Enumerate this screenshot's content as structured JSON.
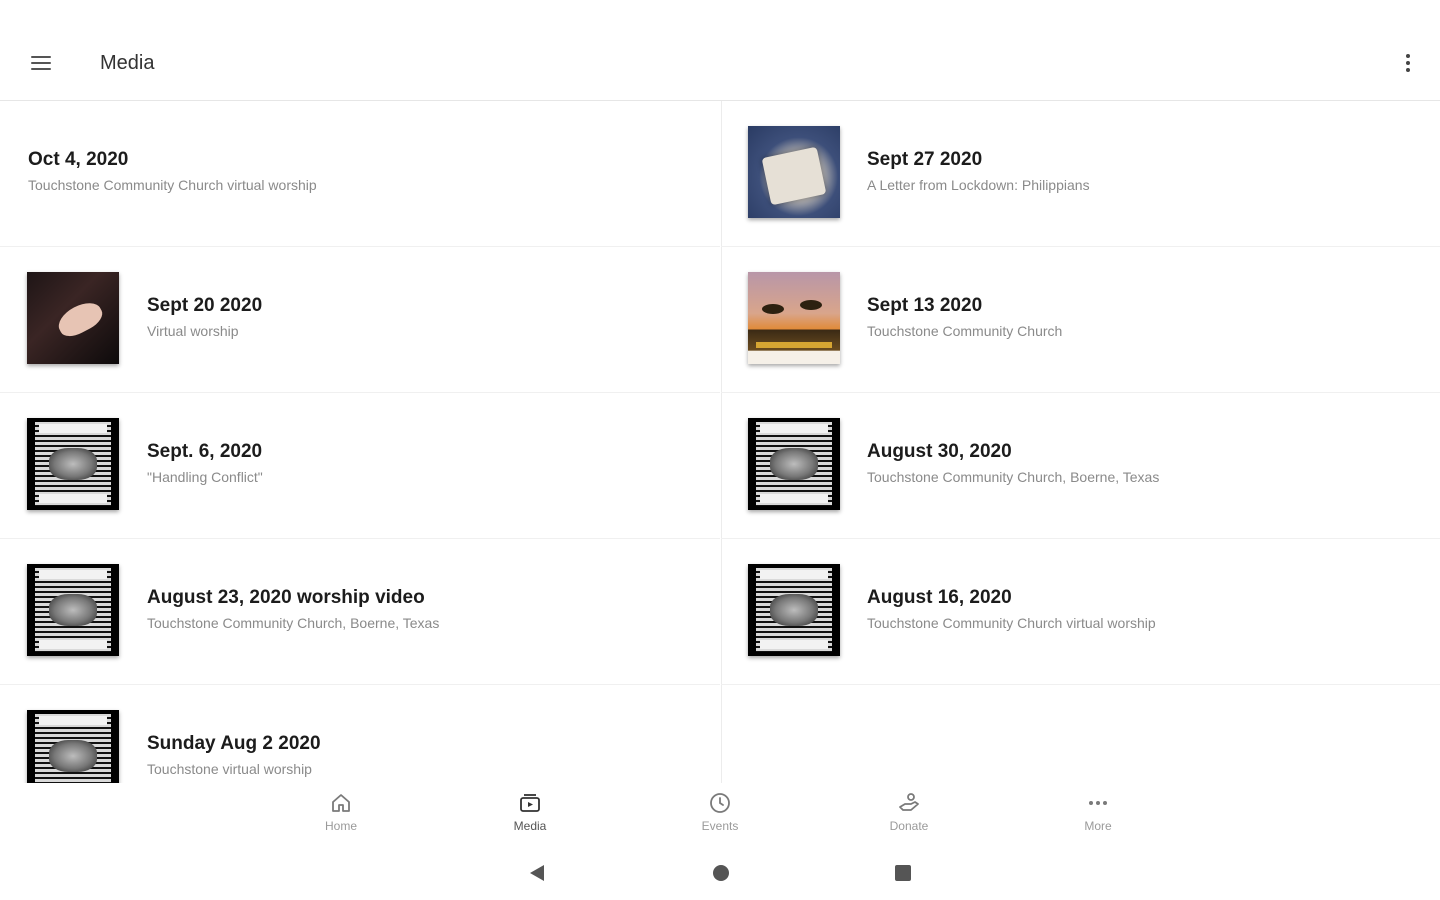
{
  "appbar": {
    "title": "Media"
  },
  "media_items": [
    {
      "title": "Oct 4, 2020",
      "subtitle": "Touchstone Community Church virtual worship",
      "thumbnail": "none"
    },
    {
      "title": "Sept 27 2020",
      "subtitle": "A Letter from Lockdown: Philippians",
      "thumbnail": "open-bible-photo"
    },
    {
      "title": "Sept 20 2020",
      "subtitle": "Virtual worship",
      "thumbnail": "open-hand-photo"
    },
    {
      "title": "Sept 13 2020",
      "subtitle": "Touchstone Community Church",
      "thumbnail": "sunset-trees-poster"
    },
    {
      "title": "Sept. 6, 2020",
      "subtitle": "\"Handling Conflict\"",
      "thumbnail": "reading-stories-of-jesus-poster"
    },
    {
      "title": "August 30, 2020",
      "subtitle": "Touchstone Community Church, Boerne, Texas",
      "thumbnail": "reading-stories-of-jesus-poster"
    },
    {
      "title": "August 23, 2020 worship video",
      "subtitle": "Touchstone Community Church, Boerne, Texas",
      "thumbnail": "reading-stories-of-jesus-poster"
    },
    {
      "title": "August 16, 2020",
      "subtitle": "Touchstone Community Church virtual worship",
      "thumbnail": "reading-stories-of-jesus-poster"
    },
    {
      "title": "Sunday Aug 2 2020",
      "subtitle": "Touchstone virtual worship",
      "thumbnail": "reading-stories-of-jesus-poster"
    }
  ],
  "bottom_nav": [
    {
      "label": "Home",
      "icon": "home-icon"
    },
    {
      "label": "Media",
      "icon": "media-icon",
      "active": true
    },
    {
      "label": "Events",
      "icon": "clock-icon"
    },
    {
      "label": "Donate",
      "icon": "donate-icon"
    },
    {
      "label": "More",
      "icon": "more-horizontal-icon"
    }
  ],
  "system_nav": {
    "buttons": [
      "back-icon",
      "home-circle-icon",
      "recents-square-icon"
    ]
  },
  "colors": {
    "text_primary": "#1c1c1c",
    "text_secondary": "#8a8a8a",
    "nav_label": "#9a9a9a",
    "divider": "#ececec"
  }
}
